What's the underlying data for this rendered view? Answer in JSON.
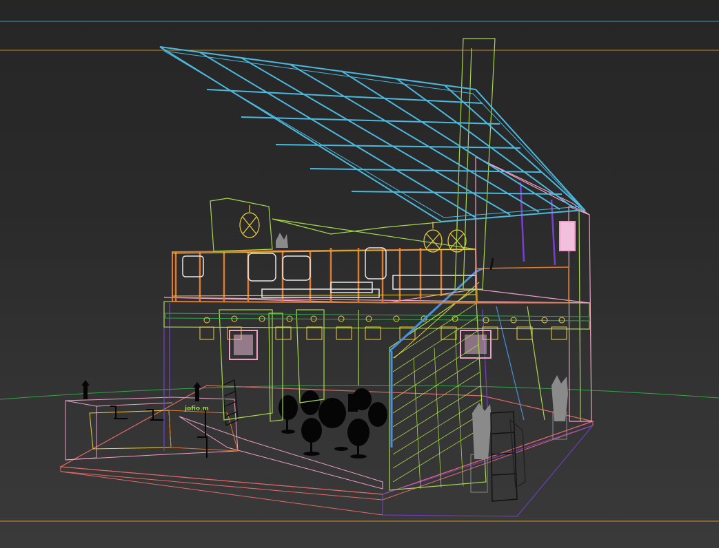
{
  "viewport": {
    "name": "3d-wireframe-viewport",
    "background_color": "#2f2f2f",
    "frame_line_top_color": "#3aa3a0",
    "frame_line_gold_color": "#c9912a"
  },
  "scene": {
    "subject": "exhibition-booth-two-storey-wireframe",
    "colors": {
      "roof_grid": "#4cb9df",
      "column_green": "#a8d84b",
      "rail_orange": "#e07a2c",
      "pink": "#f0a0c8",
      "purple": "#7a3fd0",
      "blue": "#4a90e0",
      "yellow": "#f0d040",
      "floor_outline": "#e06a6a",
      "black_furniture": "#050505"
    },
    "booth_logo_text": "jofio.m"
  }
}
